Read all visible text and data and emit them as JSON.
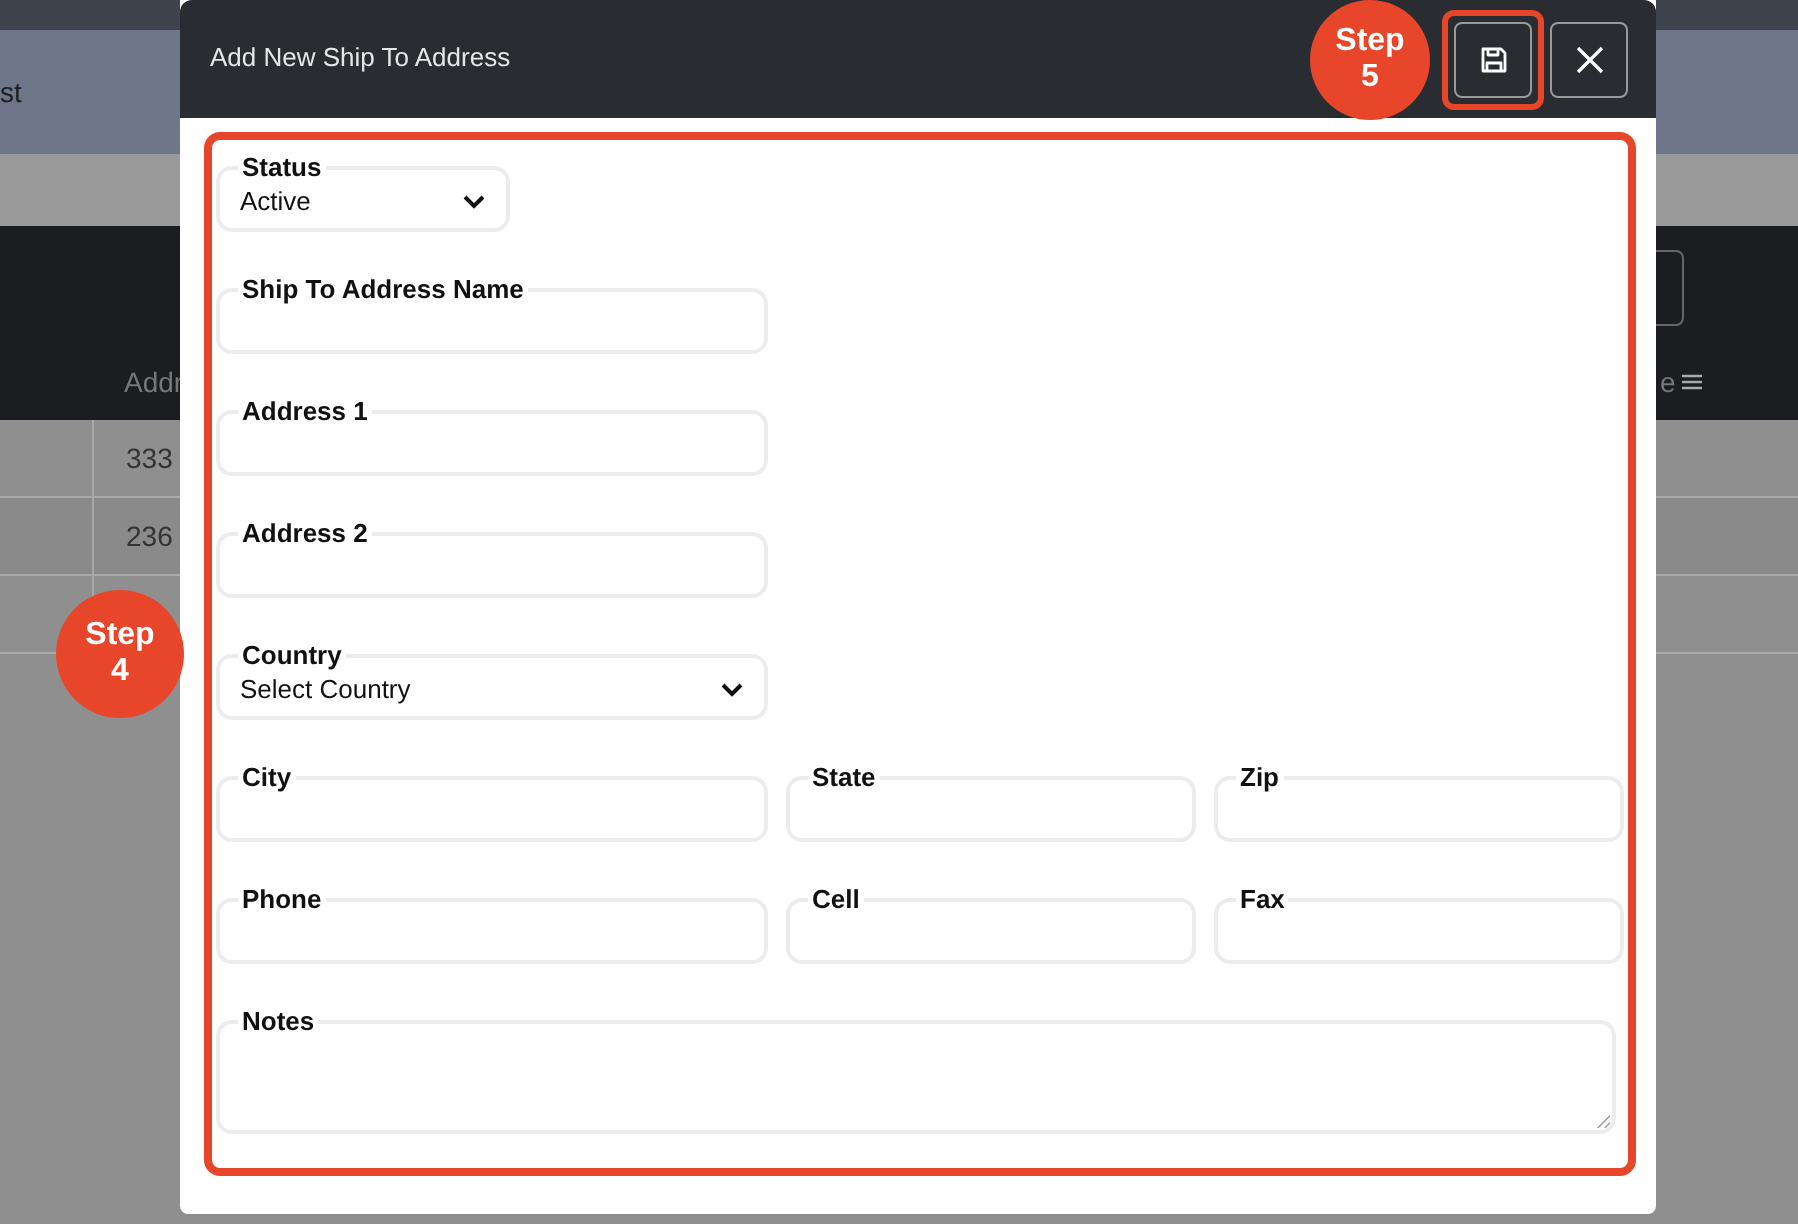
{
  "background": {
    "page_title": "st",
    "table": {
      "columns": [
        "Addr",
        "e"
      ],
      "rows": [
        [
          "333"
        ],
        [
          "236"
        ],
        [
          ""
        ]
      ]
    }
  },
  "dialog": {
    "title": "Add New Ship To Address",
    "rows": [
      [
        {
          "kind": "select",
          "label": "Status",
          "value": "Active"
        }
      ],
      [
        {
          "kind": "text",
          "label": "Ship To Address Name"
        }
      ],
      [
        {
          "kind": "text",
          "label": "Address 1"
        }
      ],
      [
        {
          "kind": "text",
          "label": "Address 2"
        }
      ],
      [
        {
          "kind": "select",
          "label": "Country",
          "value": "Select Country"
        }
      ],
      [
        {
          "kind": "text",
          "label": "City"
        },
        {
          "kind": "text",
          "label": "State"
        },
        {
          "kind": "text",
          "label": "Zip"
        }
      ],
      [
        {
          "kind": "text",
          "label": "Phone"
        },
        {
          "kind": "text",
          "label": "Cell"
        },
        {
          "kind": "text",
          "label": "Fax"
        }
      ],
      [
        {
          "kind": "textarea",
          "label": "Notes"
        }
      ]
    ]
  },
  "callouts": [
    {
      "text": "Step\n5"
    },
    {
      "text": "Step\n4"
    }
  ]
}
